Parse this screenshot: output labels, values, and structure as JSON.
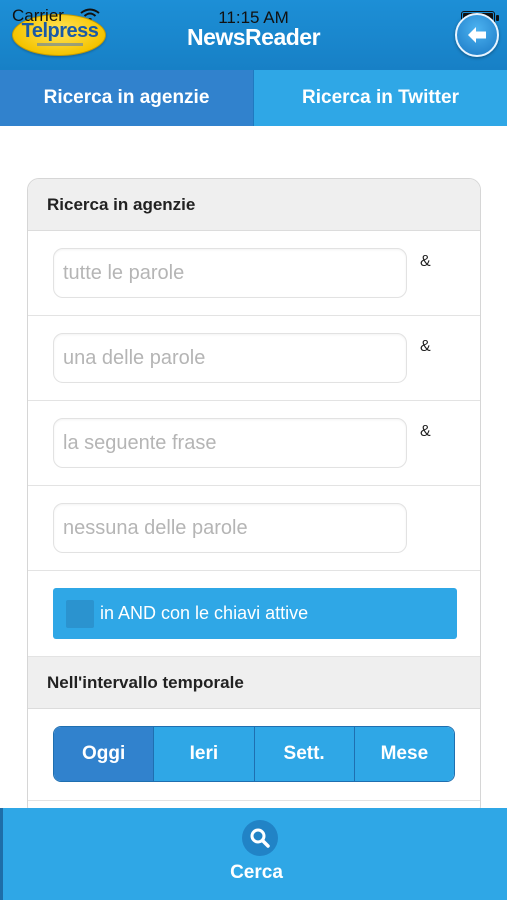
{
  "status_bar": {
    "carrier": "Carrier",
    "time": "11:15 AM"
  },
  "header": {
    "logo_text": "Telpress",
    "title": "NewsReader",
    "back_icon": "arrow-left-icon"
  },
  "tabs": [
    {
      "label": "Ricerca in agenzie",
      "active": true
    },
    {
      "label": "Ricerca in Twitter",
      "active": false
    }
  ],
  "search_panel": {
    "title": "Ricerca in agenzie",
    "fields": [
      {
        "placeholder": "tutte le parole",
        "value": "",
        "suffix": "&"
      },
      {
        "placeholder": "una delle parole",
        "value": "",
        "suffix": "&"
      },
      {
        "placeholder": "la seguente frase",
        "value": "",
        "suffix": "&"
      },
      {
        "placeholder": "nessuna delle parole",
        "value": ""
      }
    ],
    "and_toggle": {
      "label": "in AND con le chiavi attive",
      "checked": false
    }
  },
  "time_section": {
    "title": "Nell'intervallo temporale",
    "options": [
      {
        "label": "Oggi",
        "selected": true
      },
      {
        "label": "Ieri",
        "selected": false
      },
      {
        "label": "Sett.",
        "selected": false
      },
      {
        "label": "Mese",
        "selected": false
      }
    ]
  },
  "footer": {
    "search_label": "Cerca",
    "icon": "search-icon"
  },
  "colors": {
    "header_blue": "#1780c6",
    "tab_active": "#3182cd",
    "accent_blue": "#2fa7e6",
    "logo_yellow": "#f5c400"
  }
}
